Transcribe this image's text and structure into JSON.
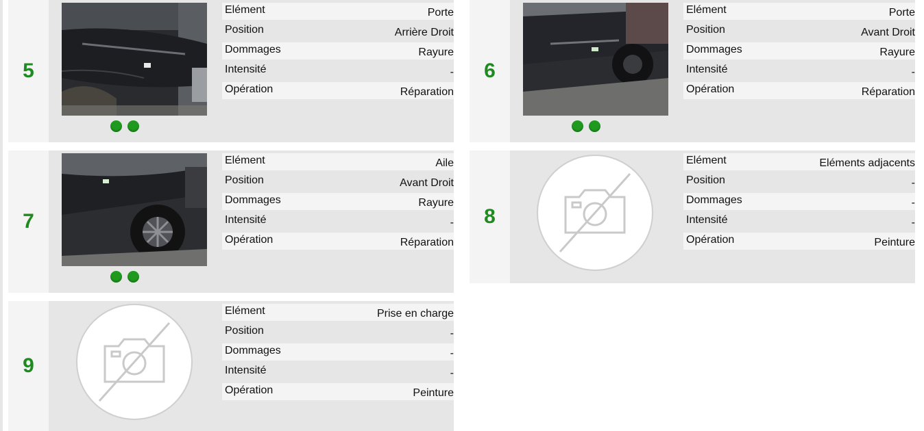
{
  "labels": {
    "element": "Elément",
    "position": "Position",
    "damage": "Dommages",
    "intensity": "Intensité",
    "operation": "Opération"
  },
  "cards": [
    {
      "number": "5",
      "element": "Porte",
      "position": "Arrière Droit",
      "damage": "Rayure",
      "intensity": "-",
      "operation": "Réparation",
      "photos": 2
    },
    {
      "number": "6",
      "element": "Porte",
      "position": "Avant Droit",
      "damage": "Rayure",
      "intensity": "-",
      "operation": "Réparation",
      "photos": 2
    },
    {
      "number": "7",
      "element": "Aile",
      "position": "Avant Droit",
      "damage": "Rayure",
      "intensity": "-",
      "operation": "Réparation",
      "photos": 2
    },
    {
      "number": "8",
      "element": "Eléments adjacents",
      "position": "-",
      "damage": "-",
      "intensity": "-",
      "operation": "Peinture",
      "photos": 0
    },
    {
      "number": "9",
      "element": "Prise en charge",
      "position": "-",
      "damage": "-",
      "intensity": "-",
      "operation": "Peinture",
      "photos": 0
    }
  ],
  "colors": {
    "number": "#1f8a1f",
    "dot": "#1f9a1f",
    "card_bg": "#e6e6e6",
    "row_light": "#f4f4f4"
  },
  "icons": {
    "no_photo": "camera-off-icon",
    "indicator": "photo-indicator-dot"
  }
}
